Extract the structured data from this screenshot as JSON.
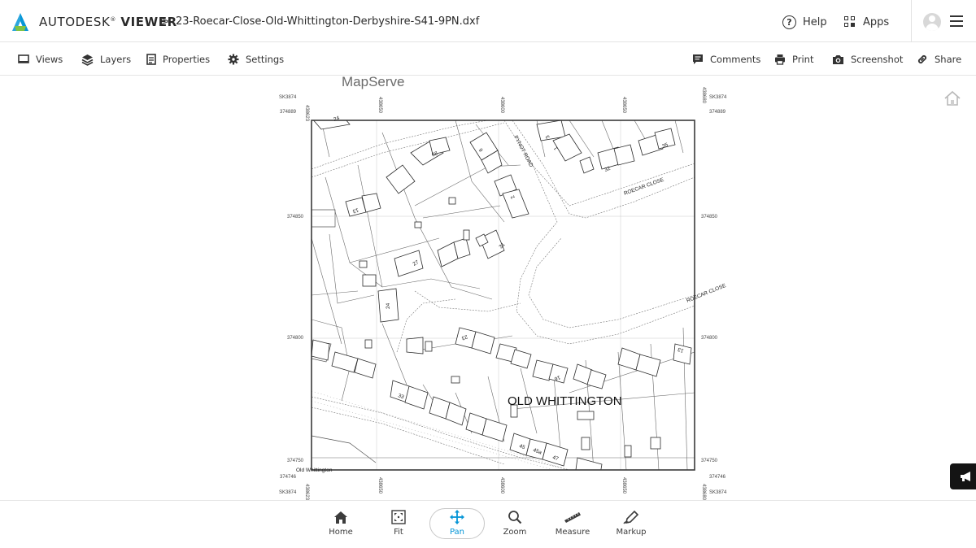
{
  "header": {
    "brand_light": "AUTODESK",
    "brand_mark": "®",
    "brand_bold": "VIEWER",
    "breadcrumb_separator": ">",
    "file_name": "23-Roecar-Close-Old-Whittington-Derbyshire-S41-9PN.dxf",
    "help_label": "Help",
    "apps_label": "Apps",
    "icons": [
      "autodesk-logo-icon",
      "help-icon",
      "apps-icon",
      "avatar",
      "hamburger-menu-icon"
    ]
  },
  "toolbar": {
    "left": [
      {
        "label": "Views",
        "icon": "views-icon"
      },
      {
        "label": "Layers",
        "icon": "layers-icon"
      },
      {
        "label": "Properties",
        "icon": "properties-icon"
      },
      {
        "label": "Settings",
        "icon": "gear-icon"
      }
    ],
    "right": [
      {
        "label": "Comments",
        "icon": "comment-icon"
      },
      {
        "label": "Print",
        "icon": "printer-icon"
      },
      {
        "label": "Screenshot",
        "icon": "camera-icon"
      },
      {
        "label": "Share",
        "icon": "link-icon"
      }
    ]
  },
  "drawing": {
    "watermark": "MapServe",
    "place_name": "OLD WHITTINGTON",
    "corner_label_bottom": "Old Whittington",
    "grid_ref": "SK3874",
    "eastings": [
      "438623",
      "438650",
      "438600",
      "438650",
      "438680"
    ],
    "northings_left": [
      "374889",
      "374850",
      "374800",
      "374750",
      "374746"
    ],
    "northings_right": [
      "374889",
      "374850",
      "374800",
      "374750",
      "374746"
    ],
    "roads": [
      "PYNOT ROAD",
      "ROECAR CLOSE",
      "ROECAR CLOSE"
    ],
    "house_numbers": [
      "24",
      "29",
      "6",
      "3",
      "1",
      "32",
      "35",
      "13",
      "2",
      "31",
      "27",
      "24",
      "23",
      "16",
      "13",
      "33",
      "45",
      "45a",
      "47"
    ]
  },
  "bottom_nav": {
    "items": [
      {
        "label": "Home",
        "icon": "home-icon"
      },
      {
        "label": "Fit",
        "icon": "fit-icon"
      },
      {
        "label": "Pan",
        "icon": "pan-icon"
      },
      {
        "label": "Zoom",
        "icon": "zoom-icon"
      },
      {
        "label": "Measure",
        "icon": "ruler-icon"
      },
      {
        "label": "Markup",
        "icon": "pen-icon"
      }
    ],
    "active": "Pan"
  },
  "colors": {
    "accent": "#0696d7",
    "logo_blue": "#0696d7",
    "logo_green": "#80c342",
    "feedback_bg": "#141414"
  }
}
